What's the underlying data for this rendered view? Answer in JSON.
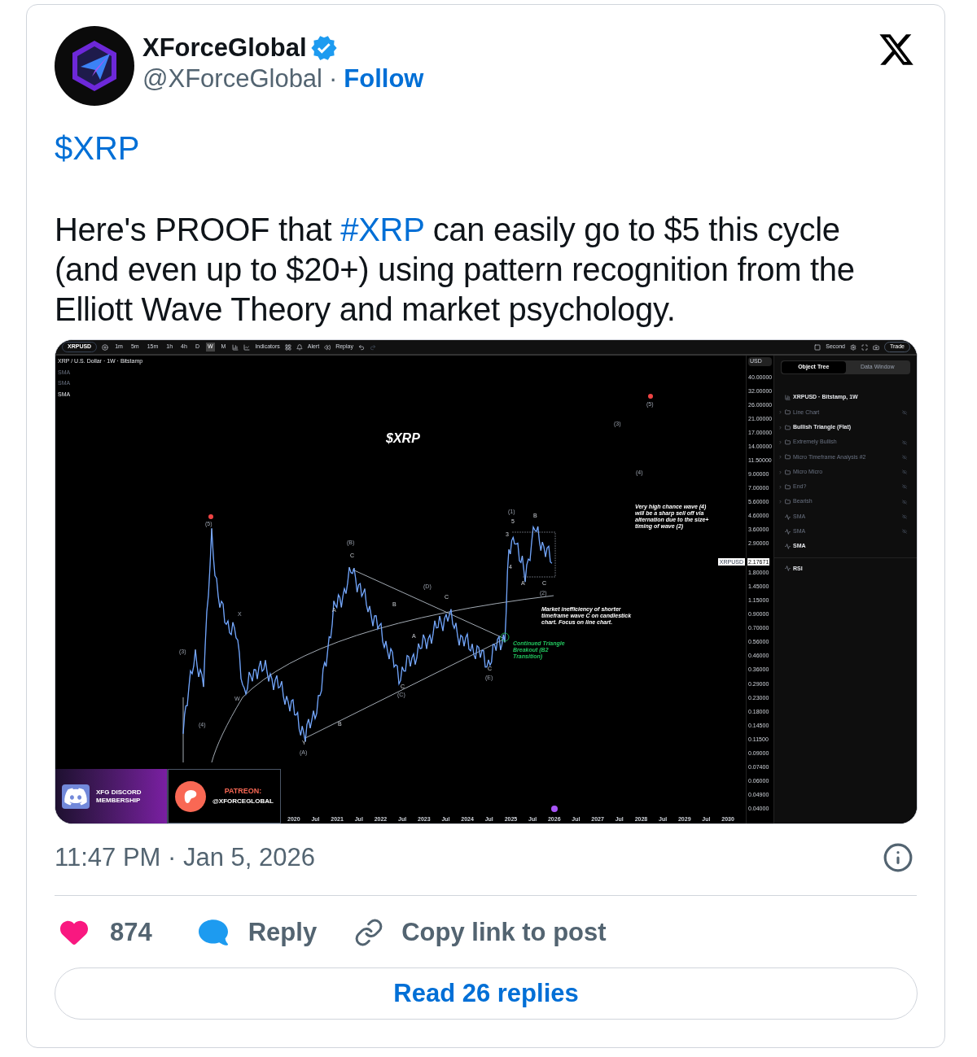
{
  "author": {
    "name": "XForceGlobal",
    "verified": true,
    "handle": "@XForceGlobal",
    "separator": "·",
    "follow": "Follow"
  },
  "cashtag": "$XRP",
  "body": {
    "before": "Here's PROOF that ",
    "hashtag": "#XRP",
    "after": " can easily go to $5 this cycle (and even up to $20+) using pattern recognition from the Elliott Wave Theory and market psychology."
  },
  "chart_screenshot": {
    "toolbar": {
      "symbol": "XRPUSD",
      "timeframes": [
        {
          "label": "1m",
          "selected": false
        },
        {
          "label": "5m",
          "selected": false
        },
        {
          "label": "15m",
          "selected": false
        },
        {
          "label": "1h",
          "selected": false
        },
        {
          "label": "4h",
          "selected": false
        },
        {
          "label": "D",
          "selected": false
        },
        {
          "label": "W",
          "selected": true
        },
        {
          "label": "M",
          "selected": false
        }
      ],
      "indicators": "Indicators",
      "alert": "Alert",
      "replay": "Replay",
      "mode": "Second",
      "trade": "Trade"
    },
    "legend": {
      "title": "XRP / U.S. Dollar · 1W · Bitstamp",
      "studies": [
        {
          "label": "SMA",
          "visible": false
        },
        {
          "label": "SMA",
          "visible": false
        },
        {
          "label": "SMA",
          "visible": true
        }
      ]
    },
    "title": "$XRP",
    "wave_labels": [
      "(5)",
      "(3)",
      "(4)",
      "X",
      "W",
      "(B)",
      "C",
      "A",
      "B",
      "Y",
      "(A)",
      "B",
      "(D)",
      "C",
      "A",
      "C",
      "(C)",
      "(E)",
      "C",
      "(1)",
      "5",
      "3",
      "B",
      "4",
      "A",
      "C",
      "(2)",
      "(3)",
      "(5)",
      "(4)"
    ],
    "notes": [
      "Very high chance wave (4) will be a sharp sell off via alternation due to the size+ timing of wave (2)",
      "Market inefficiency of shorter timeframe wave C on candlestick chart. Focus on line chart."
    ],
    "breakout_note": "Continued Triangle Breakout (B2 Transition)",
    "price_axis": {
      "currency": "USD",
      "labels": [
        "40.00000",
        "32.00000",
        "26.00000",
        "21.00000",
        "17.00000",
        "14.00000",
        "11.50000",
        "9.00000",
        "7.00000",
        "5.60000",
        "4.60000",
        "3.60000",
        "2.90000",
        "1.80000",
        "1.45000",
        "1.15000",
        "0.90000",
        "0.70000",
        "0.56000",
        "0.46000",
        "0.36000",
        "0.29000",
        "0.23000",
        "0.18000",
        "0.14500",
        "0.11500",
        "0.09000",
        "0.07400",
        "0.06000",
        "0.04900",
        "0.04000"
      ],
      "tag_symbol": "XRPUSD",
      "tag_price": "2.17671"
    },
    "time_axis": [
      "2020",
      "Jul",
      "2021",
      "Jul",
      "2022",
      "Jul",
      "2023",
      "Jul",
      "2024",
      "Jul",
      "2025",
      "Jul",
      "2026",
      "Jul",
      "2027",
      "Jul",
      "2028",
      "Jul",
      "2029",
      "Jul",
      "2030"
    ],
    "panel": {
      "tabs": [
        {
          "label": "Object Tree",
          "selected": true
        },
        {
          "label": "Data Window",
          "selected": false
        }
      ],
      "items": [
        {
          "kind": "symbol",
          "label": "XRPUSD · Bitstamp, 1W",
          "visible": true
        },
        {
          "kind": "folder",
          "label": "Line Chart",
          "visible": false
        },
        {
          "kind": "folder",
          "label": "Bullish Triangle (Flat)",
          "visible": true
        },
        {
          "kind": "folder",
          "label": "Extremely Bullish",
          "visible": false
        },
        {
          "kind": "folder",
          "label": "Micro Timeframe Analysis #2",
          "visible": false
        },
        {
          "kind": "folder",
          "label": "Micro Micro",
          "visible": false
        },
        {
          "kind": "folder",
          "label": "End?",
          "visible": false
        },
        {
          "kind": "folder",
          "label": "Bearish",
          "visible": false
        },
        {
          "kind": "study",
          "label": "SMA",
          "visible": false
        },
        {
          "kind": "study",
          "label": "SMA",
          "visible": false
        },
        {
          "kind": "study",
          "label": "SMA",
          "visible": true
        }
      ],
      "pane_items": [
        {
          "kind": "study",
          "label": "RSI",
          "visible": true
        }
      ]
    },
    "banners": {
      "discord": "XFG DISCORD MEMBERSHIP",
      "patreon_title": "PATREON:",
      "patreon_handle": "@XFORCEGLOBAL"
    }
  },
  "timestamp": "11:47 PM · Jan 5, 2026",
  "actions": {
    "likes": "874",
    "reply": "Reply",
    "copy_link": "Copy link to post"
  },
  "read_replies": "Read 26 replies"
}
